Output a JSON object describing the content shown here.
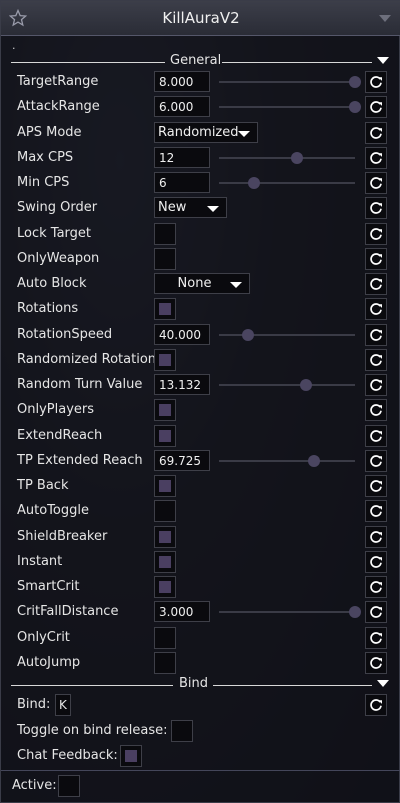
{
  "window": {
    "title": "KillAuraV2",
    "star_icon": "star-icon",
    "collapse_icon": "chevron-down-icon",
    "subtitle": "."
  },
  "sections": {
    "general": "General",
    "bind": "Bind"
  },
  "settings": [
    {
      "label": "TargetRange",
      "type": "slider",
      "value": "8.000",
      "level": 1.0
    },
    {
      "label": "AttackRange",
      "type": "slider",
      "value": "6.000",
      "level": 1.0
    },
    {
      "label": "APS Mode",
      "type": "dropdown",
      "value": "Randomized"
    },
    {
      "label": "Max CPS",
      "type": "slider",
      "value": "12",
      "level": 0.57
    },
    {
      "label": "Min CPS",
      "type": "slider",
      "value": "6",
      "level": 0.26
    },
    {
      "label": "Swing Order",
      "type": "dropdown",
      "value": "New"
    },
    {
      "label": "Lock Target",
      "type": "checkbox",
      "checked": false
    },
    {
      "label": "OnlyWeapon",
      "type": "checkbox",
      "checked": false
    },
    {
      "label": "Auto Block",
      "type": "dropdown",
      "value": "None"
    },
    {
      "label": "Rotations",
      "type": "checkbox",
      "checked": true
    },
    {
      "label": "RotationSpeed",
      "type": "slider",
      "value": "40.000",
      "level": 0.21
    },
    {
      "label": "Randomized Rotation",
      "type": "checkbox",
      "checked": true
    },
    {
      "label": "Random Turn Value",
      "type": "slider",
      "value": "13.132",
      "level": 0.64
    },
    {
      "label": "OnlyPlayers",
      "type": "checkbox",
      "checked": true
    },
    {
      "label": "ExtendReach",
      "type": "checkbox",
      "checked": true
    },
    {
      "label": "TP Extended Reach",
      "type": "slider",
      "value": "69.725",
      "level": 0.7
    },
    {
      "label": "TP Back",
      "type": "checkbox",
      "checked": true
    },
    {
      "label": "AutoToggle",
      "type": "checkbox",
      "checked": false
    },
    {
      "label": "ShieldBreaker",
      "type": "checkbox",
      "checked": true
    },
    {
      "label": "Instant",
      "type": "checkbox",
      "checked": true
    },
    {
      "label": "SmartCrit",
      "type": "checkbox",
      "checked": true
    },
    {
      "label": "CritFallDistance",
      "type": "slider",
      "value": "3.000",
      "level": 1.0
    },
    {
      "label": "OnlyCrit",
      "type": "checkbox",
      "checked": false
    },
    {
      "label": "AutoJump",
      "type": "checkbox",
      "checked": false
    }
  ],
  "bind": {
    "bind_label": "Bind:",
    "bind_key": "K",
    "toggle_release_label": "Toggle on bind release:",
    "toggle_release": false,
    "chat_feedback_label": "Chat Feedback:",
    "chat_feedback": true
  },
  "active": {
    "label": "Active:",
    "checked": false
  },
  "icons": {
    "reset": "reset-icon"
  },
  "colors": {
    "checked_fill": "#4a3f61",
    "knob": "#4a4560",
    "titlebar": "#33353f"
  }
}
